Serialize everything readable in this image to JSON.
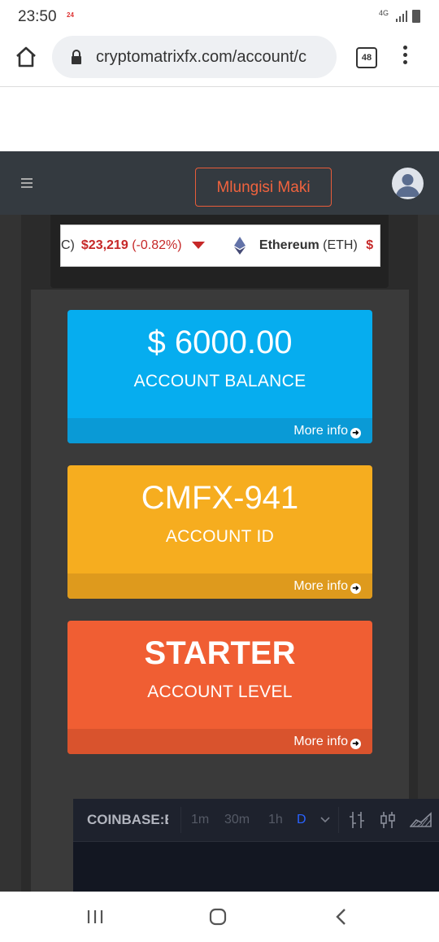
{
  "status_bar": {
    "time": "23:50",
    "notification_badge": "24",
    "network": "4G"
  },
  "browser": {
    "url": "cryptomatrixfx.com/account/c",
    "tab_count": "48"
  },
  "navbar": {
    "user_name": "Mlungisi Maki"
  },
  "ticker": {
    "prev_symbol_fragment": "C)",
    "prev_price": "$23,219",
    "prev_change": "(-0.82%)",
    "coin_name": "Ethereum",
    "coin_symbol": "(ETH)",
    "next_price_fragment": "$",
    "colors": {
      "down": "#c62828",
      "text": "#333333"
    }
  },
  "cards": [
    {
      "value": "$ 6000.00",
      "label": "ACCOUNT BALANCE",
      "link": "More info",
      "color": "#06adef"
    },
    {
      "value": "CMFX-941",
      "label": "ACCOUNT ID",
      "link": "More info",
      "color": "#f6ad1f"
    },
    {
      "value": "STARTER",
      "label": "ACCOUNT LEVEL",
      "link": "More info",
      "color": "#f05e33"
    }
  ],
  "chart_widget": {
    "symbol": "COINBASE:E",
    "timeframes": [
      "1m",
      "30m",
      "1h",
      "D"
    ],
    "active_timeframe": "D"
  },
  "icons": {
    "home": "home-icon",
    "lock": "lock-icon",
    "menu": "more-vert-icon",
    "hamburger": "hamburger-icon",
    "avatar": "user-avatar-icon",
    "recent": "recent-apps-icon",
    "home_nav": "home-nav-icon",
    "back": "back-icon"
  }
}
